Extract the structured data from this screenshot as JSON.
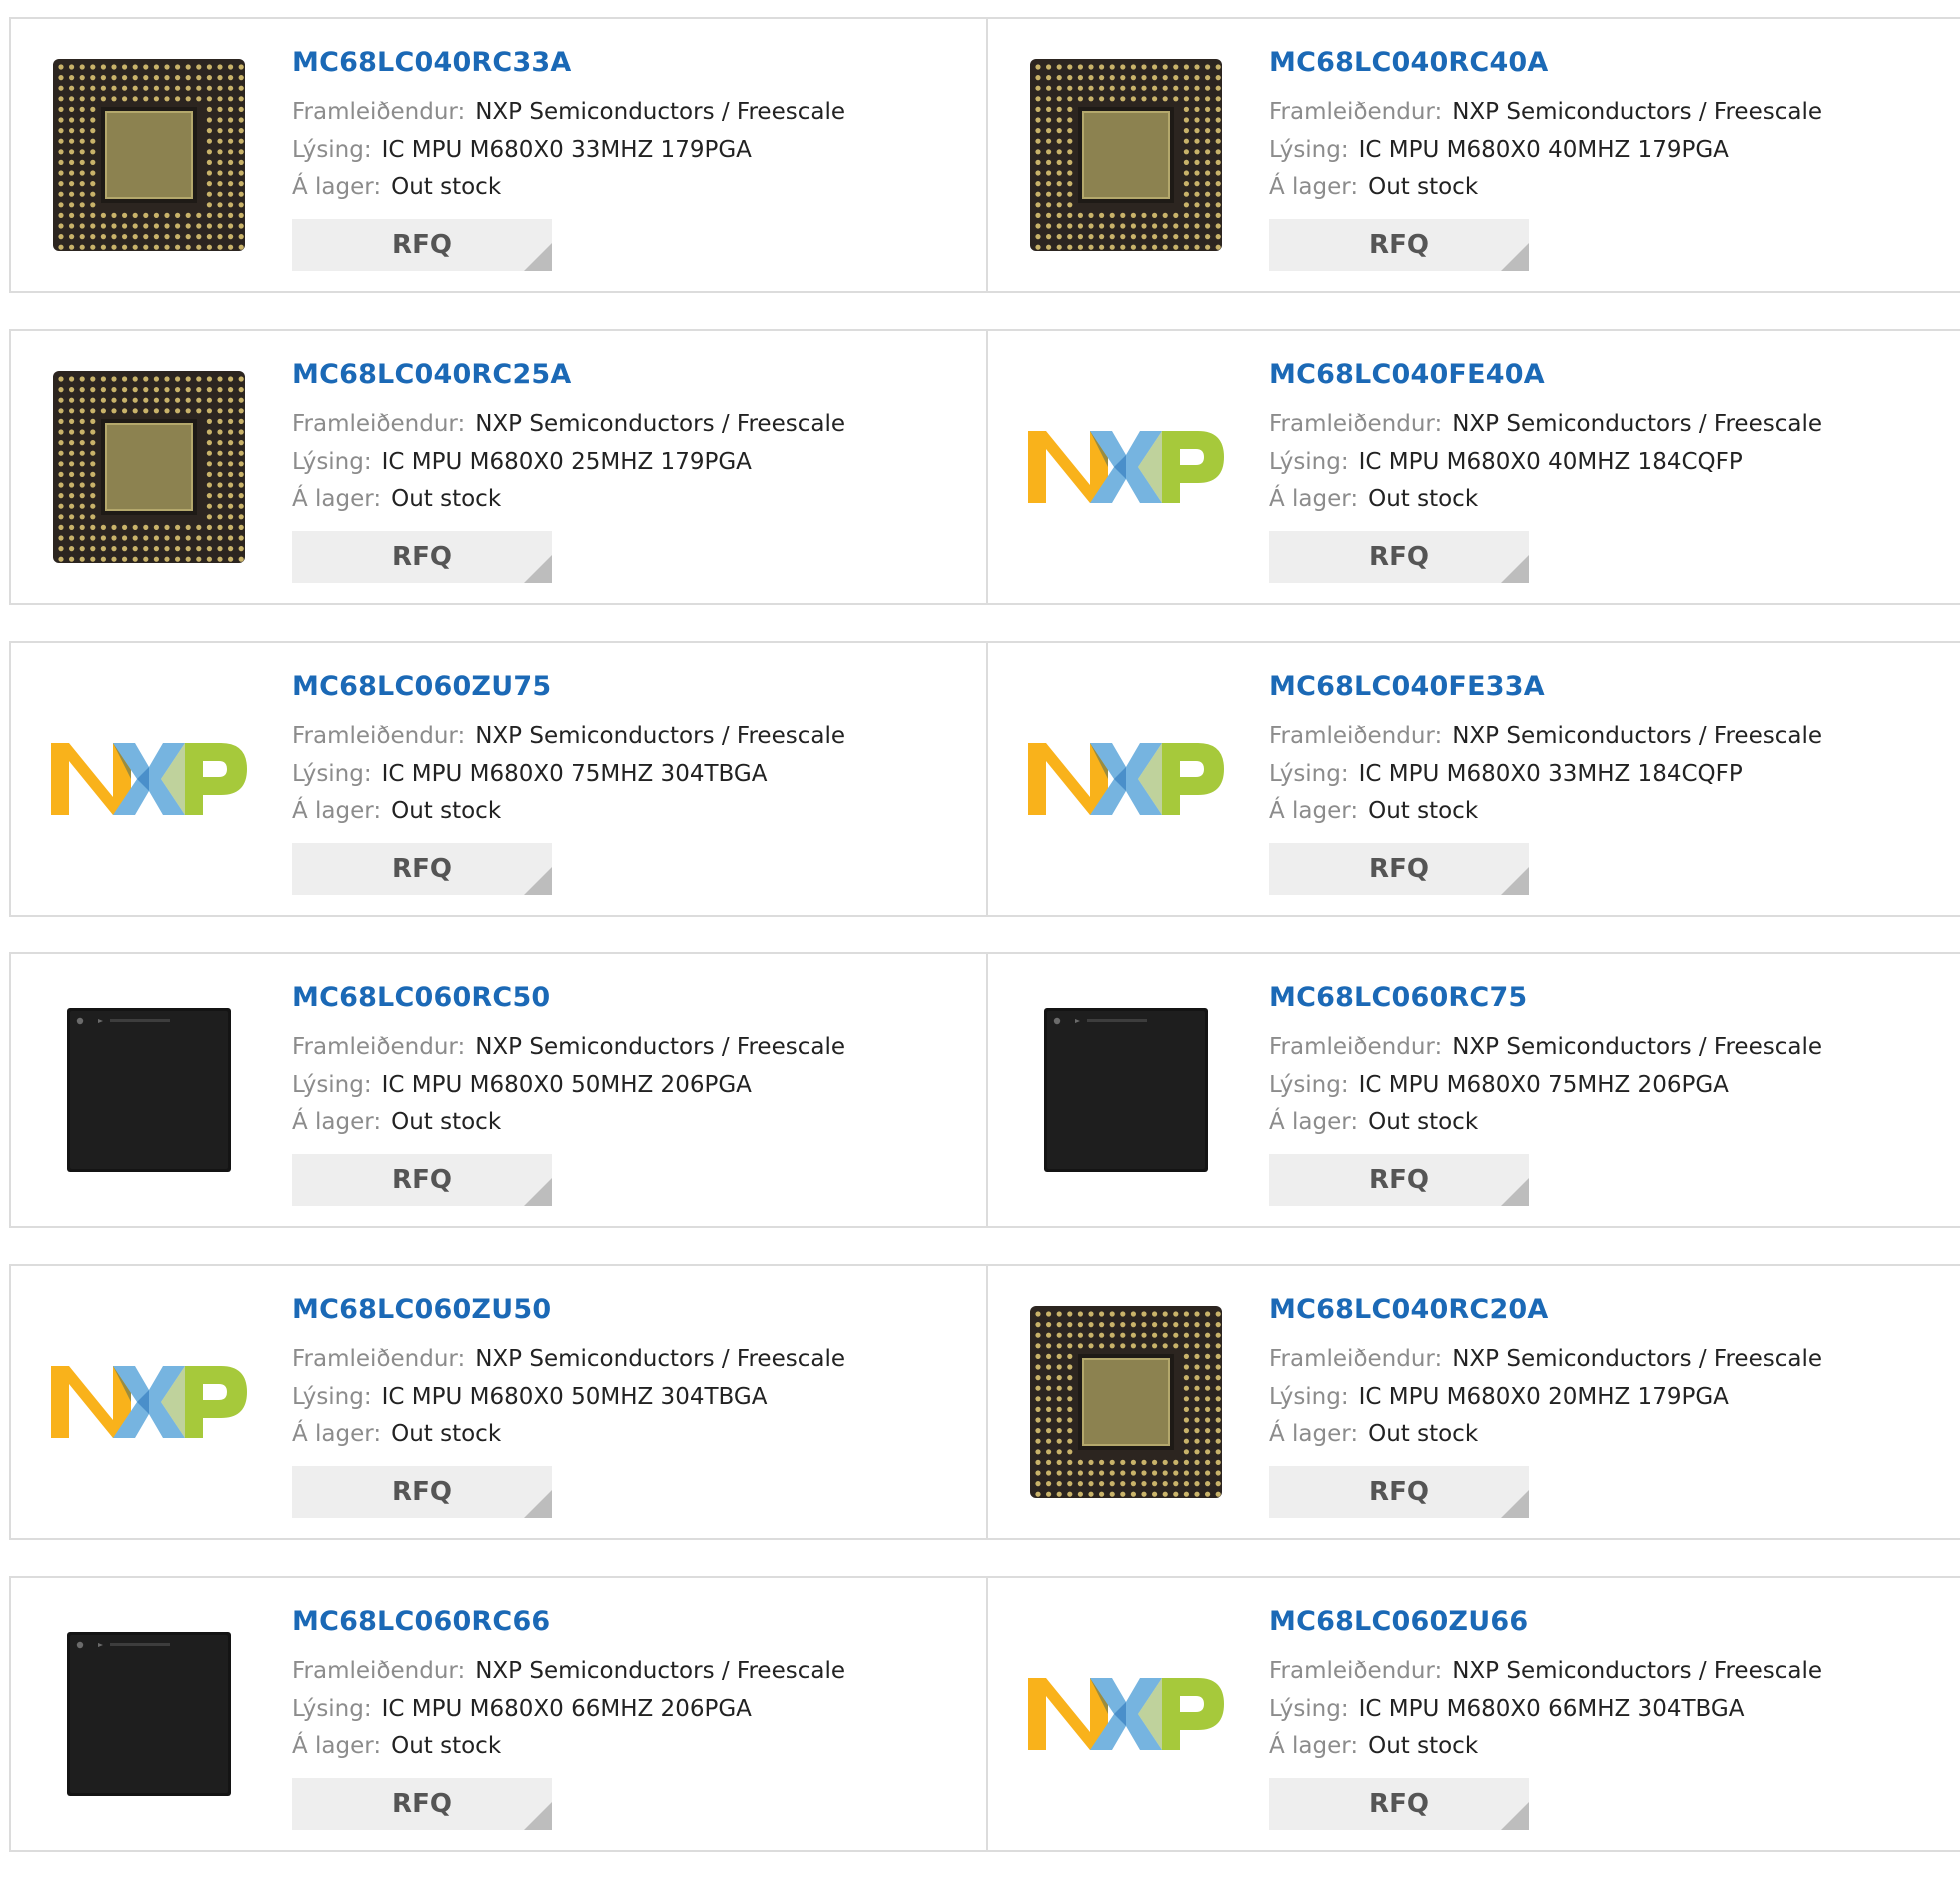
{
  "labels": {
    "manufacturer": "Framleiðendur:",
    "description": "Lýsing:",
    "stock": "Á lager:",
    "rfq": "RFQ"
  },
  "products": [
    {
      "part": "MC68LC040RC33A",
      "manufacturer": "NXP Semiconductors / Freescale",
      "description": "IC MPU M680X0 33MHZ 179PGA",
      "stock": "Out stock",
      "image": "pga"
    },
    {
      "part": "MC68LC040RC40A",
      "manufacturer": "NXP Semiconductors / Freescale",
      "description": "IC MPU M680X0 40MHZ 179PGA",
      "stock": "Out stock",
      "image": "pga"
    },
    {
      "part": "MC68LC040RC25A",
      "manufacturer": "NXP Semiconductors / Freescale",
      "description": "IC MPU M680X0 25MHZ 179PGA",
      "stock": "Out stock",
      "image": "pga"
    },
    {
      "part": "MC68LC040FE40A",
      "manufacturer": "NXP Semiconductors / Freescale",
      "description": "IC MPU M680X0 40MHZ 184CQFP",
      "stock": "Out stock",
      "image": "nxp"
    },
    {
      "part": "MC68LC060ZU75",
      "manufacturer": "NXP Semiconductors / Freescale",
      "description": "IC MPU M680X0 75MHZ 304TBGA",
      "stock": "Out stock",
      "image": "nxp"
    },
    {
      "part": "MC68LC040FE33A",
      "manufacturer": "NXP Semiconductors / Freescale",
      "description": "IC MPU M680X0 33MHZ 184CQFP",
      "stock": "Out stock",
      "image": "nxp"
    },
    {
      "part": "MC68LC060RC50",
      "manufacturer": "NXP Semiconductors / Freescale",
      "description": "IC MPU M680X0 50MHZ 206PGA",
      "stock": "Out stock",
      "image": "black-chip"
    },
    {
      "part": "MC68LC060RC75",
      "manufacturer": "NXP Semiconductors / Freescale",
      "description": "IC MPU M680X0 75MHZ 206PGA",
      "stock": "Out stock",
      "image": "black-chip"
    },
    {
      "part": "MC68LC060ZU50",
      "manufacturer": "NXP Semiconductors / Freescale",
      "description": "IC MPU M680X0 50MHZ 304TBGA",
      "stock": "Out stock",
      "image": "nxp"
    },
    {
      "part": "MC68LC040RC20A",
      "manufacturer": "NXP Semiconductors / Freescale",
      "description": "IC MPU M680X0 20MHZ 179PGA",
      "stock": "Out stock",
      "image": "pga"
    },
    {
      "part": "MC68LC060RC66",
      "manufacturer": "NXP Semiconductors / Freescale",
      "description": "IC MPU M680X0 66MHZ 206PGA",
      "stock": "Out stock",
      "image": "black-chip"
    },
    {
      "part": "MC68LC060ZU66",
      "manufacturer": "NXP Semiconductors / Freescale",
      "description": "IC MPU M680X0 66MHZ 304TBGA",
      "stock": "Out stock",
      "image": "nxp"
    }
  ]
}
